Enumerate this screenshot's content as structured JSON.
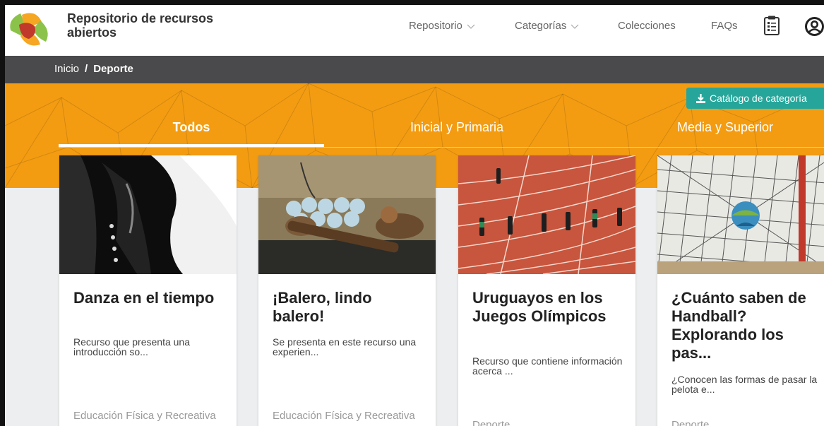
{
  "header": {
    "site_title": "Repositorio de recursos abiertos",
    "nav": [
      {
        "label": "Repositorio",
        "dropdown": true
      },
      {
        "label": "Categorías",
        "dropdown": true
      },
      {
        "label": "Colecciones",
        "dropdown": false
      },
      {
        "label": "FAQs",
        "dropdown": false
      }
    ],
    "icons": [
      "clipboard-icon",
      "user-icon"
    ]
  },
  "breadcrumb": {
    "home": "Inicio",
    "separator": "/",
    "current": "Deporte"
  },
  "banner": {
    "catalog_button": "Catálogo de categoría",
    "tabs": [
      {
        "label": "Todos",
        "active": true
      },
      {
        "label": "Inicial y Primaria",
        "active": false
      },
      {
        "label": "Media y Superior",
        "active": false
      }
    ]
  },
  "cards": [
    {
      "title": "Danza en el tiempo",
      "description": "Recurso que presenta una introducción so...",
      "category": "Educación Física y Recreativa"
    },
    {
      "title": "¡Balero, lindo balero!",
      "description": "Se presenta en este recurso una experien...",
      "category": "Educación Física y Recreativa"
    },
    {
      "title": "Uruguayos en los Juegos Olímpicos",
      "description": "Recurso que contiene información acerca ...",
      "category": "Deporte"
    },
    {
      "title": "¿Cuánto saben de Handball? Explorando los pas...",
      "description": "¿Conocen las formas de pasar la pelota e...",
      "category": "Deporte"
    }
  ],
  "colors": {
    "banner": "#f39c12",
    "breadcrumb_bar": "#4a4a4c",
    "catalog_button": "#26a69a",
    "content_bg": "#eceeef"
  }
}
